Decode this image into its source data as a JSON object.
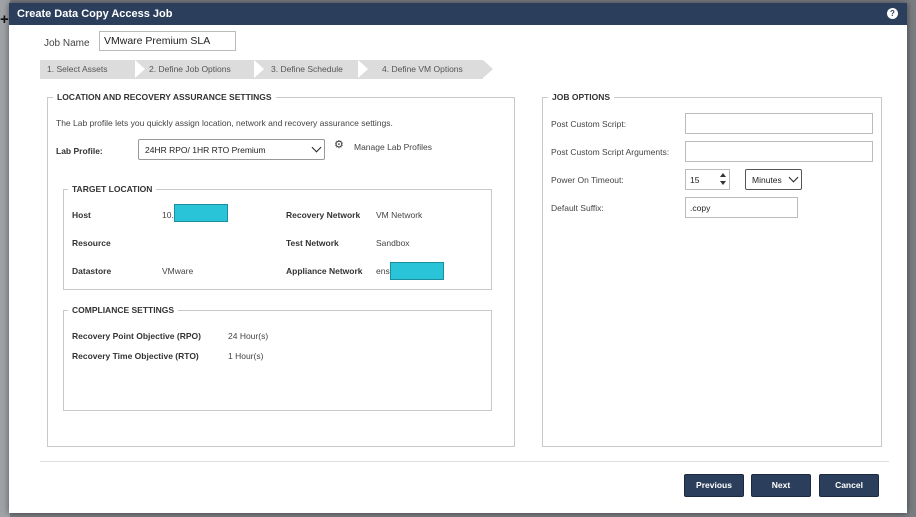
{
  "dialog": {
    "title": "Create Data Copy Access Job"
  },
  "job_name": {
    "label": "Job Name",
    "value": "VMware Premium SLA"
  },
  "wizard_steps": [
    "1. Select Assets",
    "2. Define Job Options",
    "3. Define Schedule",
    "4. Define VM Options"
  ],
  "wizard_active_step": 2,
  "location": {
    "legend": "LOCATION AND RECOVERY ASSURANCE SETTINGS",
    "description": "The Lab profile lets you quickly assign location, network and recovery assurance settings.",
    "lab_profile_label": "Lab Profile:",
    "lab_profile_value": "24HR RPO/ 1HR RTO Premium",
    "manage_link": "Manage Lab Profiles"
  },
  "target": {
    "legend": "TARGET LOCATION",
    "host_label": "Host",
    "host_value": "10.",
    "resource_label": "Resource",
    "datastore_label": "Datastore",
    "datastore_value": "VMware",
    "recovery_network_label": "Recovery Network",
    "recovery_network_value": "VM Network",
    "test_network_label": "Test Network",
    "test_network_value": "Sandbox",
    "appliance_network_label": "Appliance Network",
    "appliance_network_value": "ens"
  },
  "compliance": {
    "legend": "COMPLIANCE SETTINGS",
    "rpo_label": "Recovery Point Objective (RPO)",
    "rpo_value": "24 Hour(s)",
    "rto_label": "Recovery Time Objective (RTO)",
    "rto_value": "1 Hour(s)"
  },
  "job_options": {
    "legend": "JOB OPTIONS",
    "post_script_label": "Post Custom Script:",
    "post_script_value": "",
    "post_args_label": "Post Custom Script Arguments:",
    "post_args_value": "",
    "power_timeout_label": "Power On Timeout:",
    "power_timeout_value": "15",
    "power_timeout_unit": "Minutes",
    "default_suffix_label": "Default Suffix:",
    "default_suffix_value": ".copy"
  },
  "buttons": {
    "previous": "Previous",
    "next": "Next",
    "cancel": "Cancel"
  },
  "colors": {
    "primary": "#2b3f5c",
    "redaction": "#29c4d8",
    "wizard_step": "#dcdcdc"
  }
}
